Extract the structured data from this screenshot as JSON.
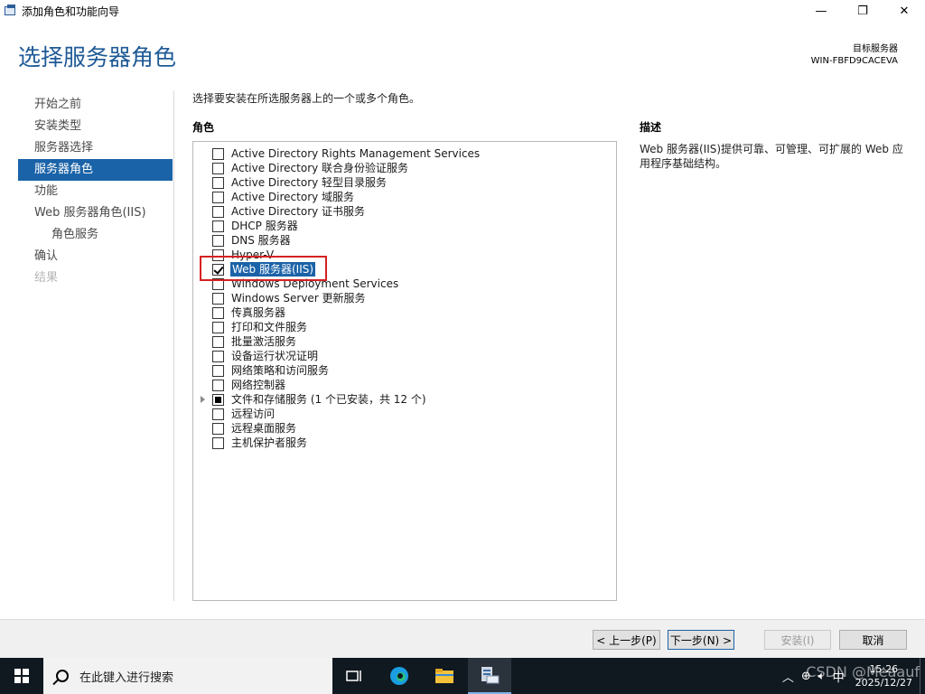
{
  "window": {
    "title": "添加角色和功能向导",
    "minimize": "—",
    "maximize": "❐",
    "close": "✕"
  },
  "header": {
    "page_title": "选择服务器角色",
    "target_label": "目标服务器",
    "target_name": "WIN-FBFD9CACEVA"
  },
  "nav": {
    "items": [
      {
        "label": "开始之前",
        "state": "normal"
      },
      {
        "label": "安装类型",
        "state": "normal"
      },
      {
        "label": "服务器选择",
        "state": "normal"
      },
      {
        "label": "服务器角色",
        "state": "active"
      },
      {
        "label": "功能",
        "state": "normal"
      },
      {
        "label": "Web 服务器角色(IIS)",
        "state": "normal"
      },
      {
        "label": "角色服务",
        "state": "sub"
      },
      {
        "label": "确认",
        "state": "normal"
      },
      {
        "label": "结果",
        "state": "disabled"
      }
    ]
  },
  "main": {
    "instruction": "选择要安装在所选服务器上的一个或多个角色。",
    "roles_heading": "角色",
    "roles": [
      {
        "label": "Active Directory Rights Management Services",
        "state": "unchecked"
      },
      {
        "label": "Active Directory 联合身份验证服务",
        "state": "unchecked"
      },
      {
        "label": "Active Directory 轻型目录服务",
        "state": "unchecked"
      },
      {
        "label": "Active Directory 域服务",
        "state": "unchecked"
      },
      {
        "label": "Active Directory 证书服务",
        "state": "unchecked"
      },
      {
        "label": "DHCP 服务器",
        "state": "unchecked"
      },
      {
        "label": "DNS 服务器",
        "state": "unchecked"
      },
      {
        "label": "Hyper-V",
        "state": "unchecked"
      },
      {
        "label": "Web 服务器(IIS)",
        "state": "checked",
        "selected": true
      },
      {
        "label": "Windows Deployment Services",
        "state": "unchecked"
      },
      {
        "label": "Windows Server 更新服务",
        "state": "unchecked"
      },
      {
        "label": "传真服务器",
        "state": "unchecked"
      },
      {
        "label": "打印和文件服务",
        "state": "unchecked"
      },
      {
        "label": "批量激活服务",
        "state": "unchecked"
      },
      {
        "label": "设备运行状况证明",
        "state": "unchecked"
      },
      {
        "label": "网络策略和访问服务",
        "state": "unchecked"
      },
      {
        "label": "网络控制器",
        "state": "unchecked"
      },
      {
        "label": "文件和存储服务 (1 个已安装，共 12 个)",
        "state": "partial",
        "expandable": true
      },
      {
        "label": "远程访问",
        "state": "unchecked"
      },
      {
        "label": "远程桌面服务",
        "state": "unchecked"
      },
      {
        "label": "主机保护者服务",
        "state": "unchecked"
      }
    ]
  },
  "description": {
    "heading": "描述",
    "text": "Web 服务器(IIS)提供可靠、可管理、可扩展的 Web 应用程序基础结构。"
  },
  "buttons": {
    "prev": "< 上一步(P)",
    "next": "下一步(N) >",
    "install": "安装(I)",
    "cancel": "取消"
  },
  "taskbar": {
    "search_placeholder": "在此键入进行搜索",
    "time": "15:26",
    "date": "2025/12/27",
    "ime": "中",
    "watermark": "CSDN @Meaauf"
  },
  "colors": {
    "accent": "#1b63a8",
    "title": "#1e5a96",
    "highlight_box": "#d62020",
    "taskbar": "#101820"
  }
}
